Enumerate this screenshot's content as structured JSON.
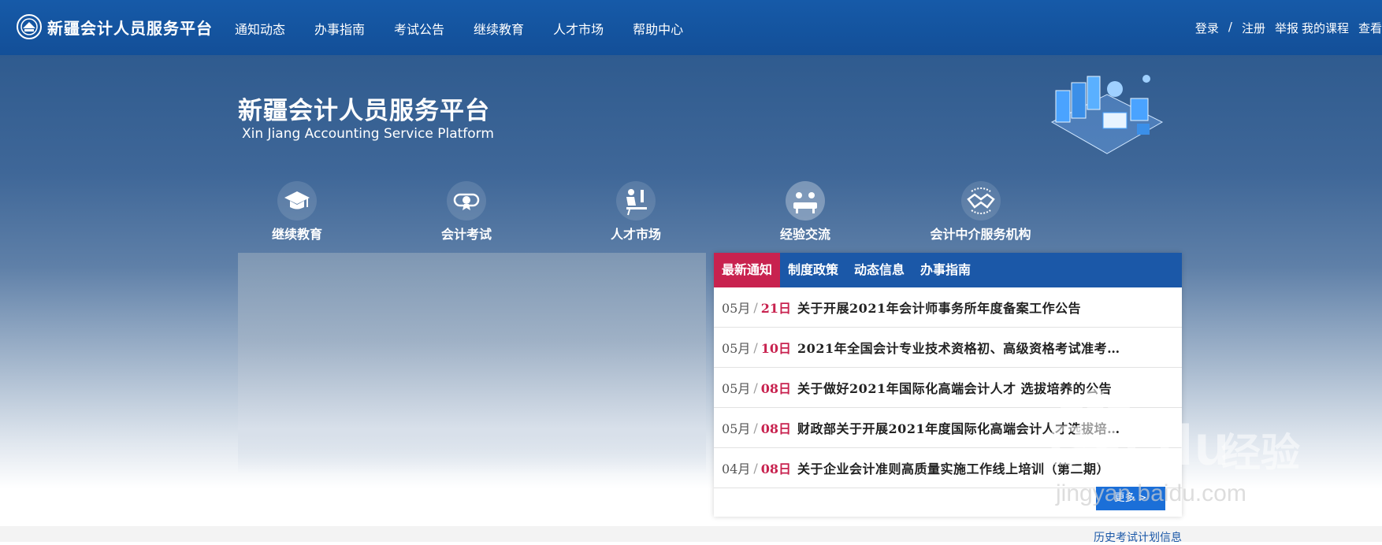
{
  "header": {
    "logo_text": "新疆会计人员服务平台",
    "nav": [
      "通知动态",
      "办事指南",
      "考试公告",
      "继续教育",
      "人才市场",
      "帮助中心"
    ],
    "user_links": {
      "login": "登录",
      "separator": "/",
      "register": "注册",
      "report": "举报",
      "my_courses": "我的课程",
      "view": "查看"
    }
  },
  "hero": {
    "title": "新疆会计人员服务平台",
    "subtitle": "Xin Jiang Accounting Service Platform"
  },
  "features": [
    {
      "label": "继续教育",
      "icon": "graduation-cap-icon"
    },
    {
      "label": "会计考试",
      "icon": "exam-certificate-icon"
    },
    {
      "label": "人才市场",
      "icon": "talent-desk-icon"
    },
    {
      "label": "经验交流",
      "icon": "meeting-icon"
    },
    {
      "label": "会计中介服务机构",
      "icon": "handshake-icon"
    }
  ],
  "news": {
    "tabs": [
      "最新通知",
      "制度政策",
      "动态信息",
      "办事指南"
    ],
    "active_tab": 0,
    "items": [
      {
        "month": "05月",
        "day": "21日",
        "title": "关于开展2021年会计师事务所年度备案工作公告"
      },
      {
        "month": "05月",
        "day": "10日",
        "title": "2021年全国会计专业技术资格初、高级资格考试准考…"
      },
      {
        "month": "05月",
        "day": "08日",
        "title": "关于做好2021年国际化高端会计人才  选拔培养的公告"
      },
      {
        "month": "05月",
        "day": "08日",
        "title": "财政部关于开展2021年度国际化高端会计人才选拔培…"
      },
      {
        "month": "04月",
        "day": "08日",
        "title": "关于企业会计准则高质量实施工作线上培训（第二期）"
      }
    ],
    "more_label": "更多 >"
  },
  "footer": {
    "history_link": "历史考试计划信息"
  },
  "watermark": {
    "brand": "Bai du",
    "cn": "经验",
    "url": "jingyan.baidu.com"
  },
  "colors": {
    "header_bg": "#165aa8",
    "accent_red": "#c8224f",
    "tab_bar_bg": "#1b58a8",
    "more_button": "#1b6fd8"
  }
}
